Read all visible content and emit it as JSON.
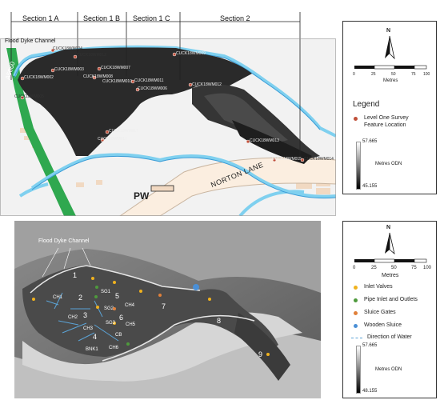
{
  "top_map": {
    "sections": [
      {
        "label": "Section 1  A"
      },
      {
        "label": "Section 1  B"
      },
      {
        "label": "Section 1  C"
      },
      {
        "label": "Section 2"
      }
    ],
    "flood_dyke_label": "Flood Dyke Channel",
    "road_label_left": "A5060",
    "road_label_norton": "NORTON LANE",
    "pw_label": "PW",
    "feature_labels": [
      "CUCK18WM004",
      "CUCK18WM012",
      "CUCK18WM003",
      "CUCK18WM002",
      "CUCK18WM007",
      "CUCK18WM008",
      "CUCK18WM009",
      "CUCK18WM010",
      "CUCK18WM011",
      "CUCK18WM012",
      "CUCK18WM006",
      "CUCK18WM005",
      "CUCK18WM017",
      "CUCK18WM016",
      "CUCK18WM013",
      "CUCK18WM015",
      "CUCK18WM014"
    ]
  },
  "top_legend": {
    "north": "N",
    "scale_ticks": [
      "0",
      "25",
      "50",
      "75",
      "100"
    ],
    "scale_unit": "Metres",
    "title": "Legend",
    "item": "Level One Survey Feature Location",
    "item_color": "#c0503a",
    "ramp_max": "57.665",
    "ramp_min": "45.155",
    "ramp_unit": "Metres ODN"
  },
  "bottom_map": {
    "flood_dyke_label": "Flood Dyke Channel",
    "zone_numbers": [
      "1",
      "2",
      "3",
      "4",
      "5",
      "6",
      "7",
      "8",
      "9"
    ],
    "channel_labels": [
      "CH1",
      "CH2",
      "CH3",
      "CH4",
      "CH5",
      "CH6",
      "CB"
    ],
    "gate_labels": [
      "SG1",
      "SG2",
      "SG3"
    ],
    "bank_label": "BNK1"
  },
  "bottom_legend": {
    "north": "N",
    "scale_ticks": [
      "0",
      "25",
      "50",
      "75",
      "100"
    ],
    "scale_unit": "Metres",
    "items": [
      {
        "label": "Inlet Valves",
        "color": "#f0b21e"
      },
      {
        "label": "Pipe Inlet and Outlets",
        "color": "#4e9a3c"
      },
      {
        "label": "Sluice Gates",
        "color": "#e0803a"
      },
      {
        "label": "Wooden Sluice",
        "color": "#4a8fd6"
      },
      {
        "label": "Direction of Water",
        "color": "#5ba3d6"
      }
    ],
    "ramp_max": "57.665",
    "ramp_min": "48.155",
    "ramp_unit": "Metres ODN"
  }
}
